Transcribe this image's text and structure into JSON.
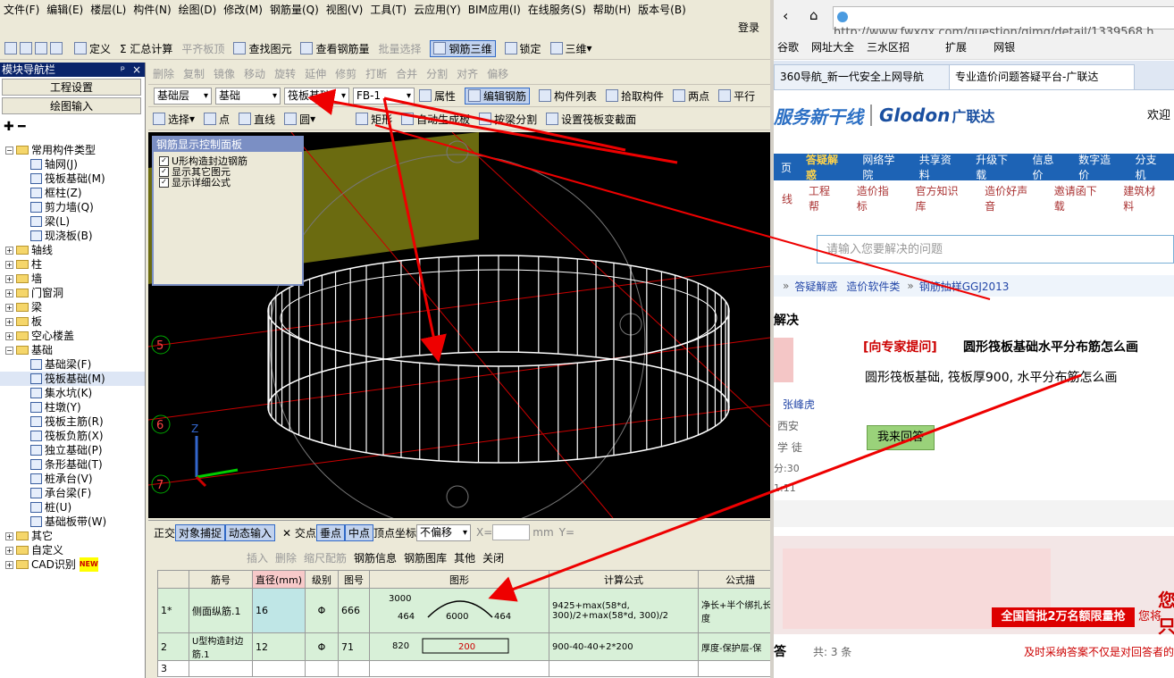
{
  "app": {
    "menu": [
      "文件(F)",
      "编辑(E)",
      "楼层(L)",
      "构件(N)",
      "绘图(D)",
      "修改(M)",
      "钢筋量(Q)",
      "视图(V)",
      "工具(T)",
      "云应用(Y)",
      "BIM应用(I)",
      "在线服务(S)",
      "帮助(H)",
      "版本号(B)"
    ],
    "login": "登录",
    "toolbar1": {
      "define": "定义",
      "sum": "Σ 汇总计算",
      "flat_top": "平齐板顶",
      "find": "查找图元",
      "view_rebar": "查看钢筋量",
      "batch": "批量选择",
      "rebar3d": "钢筋三维",
      "lock": "锁定",
      "view3d": "三维"
    },
    "toolbar2": [
      "删除",
      "复制",
      "镜像",
      "移动",
      "旋转",
      "延伸",
      "修剪",
      "打断",
      "合并",
      "分割",
      "对齐",
      "偏移"
    ],
    "toolbar3": {
      "layer": "基础层",
      "type": "基础",
      "component": "筏板基础",
      "name": "FB-1",
      "props": "属性",
      "edit_rebar": "编辑钢筋",
      "list": "构件列表",
      "pick": "拾取构件",
      "two_point": "两点",
      "parallel": "平行"
    },
    "toolbar4": {
      "select": "选择",
      "point": "点",
      "line": "直线",
      "circle": "圆",
      "rect": "矩形",
      "auto": "自动生成板",
      "split": "按梁分割",
      "set_slope": "设置筏板变截面"
    },
    "nav": {
      "title": "模块导航栏",
      "pin": "ᵖ",
      "close": "×",
      "btn1": "工程设置",
      "btn2": "绘图输入",
      "tree": [
        {
          "level": 0,
          "pm": "−",
          "label": "常用构件类型",
          "folder": true
        },
        {
          "level": 2,
          "label": "轴网(J)"
        },
        {
          "level": 2,
          "label": "筏板基础(M)"
        },
        {
          "level": 2,
          "label": "框柱(Z)"
        },
        {
          "level": 2,
          "label": "剪力墙(Q)"
        },
        {
          "level": 2,
          "label": "梁(L)"
        },
        {
          "level": 2,
          "label": "现浇板(B)"
        },
        {
          "level": 0,
          "pm": "+",
          "label": "轴线",
          "folder": true
        },
        {
          "level": 0,
          "pm": "+",
          "label": "柱",
          "folder": true
        },
        {
          "level": 0,
          "pm": "+",
          "label": "墙",
          "folder": true
        },
        {
          "level": 0,
          "pm": "+",
          "label": "门窗洞",
          "folder": true
        },
        {
          "level": 0,
          "pm": "+",
          "label": "梁",
          "folder": true
        },
        {
          "level": 0,
          "pm": "+",
          "label": "板",
          "folder": true
        },
        {
          "level": 0,
          "pm": "+",
          "label": "空心楼盖",
          "folder": true
        },
        {
          "level": 0,
          "pm": "−",
          "label": "基础",
          "folder": true
        },
        {
          "level": 2,
          "label": "基础梁(F)"
        },
        {
          "level": 2,
          "label": "筏板基础(M)",
          "selected": true
        },
        {
          "level": 2,
          "label": "集水坑(K)"
        },
        {
          "level": 2,
          "label": "柱墩(Y)"
        },
        {
          "level": 2,
          "label": "筏板主筋(R)"
        },
        {
          "level": 2,
          "label": "筏板负筋(X)"
        },
        {
          "level": 2,
          "label": "独立基础(P)"
        },
        {
          "level": 2,
          "label": "条形基础(T)"
        },
        {
          "level": 2,
          "label": "桩承台(V)"
        },
        {
          "level": 2,
          "label": "承台梁(F)"
        },
        {
          "level": 2,
          "label": "桩(U)"
        },
        {
          "level": 2,
          "label": "基础板带(W)"
        },
        {
          "level": 0,
          "pm": "+",
          "label": "其它",
          "folder": true
        },
        {
          "level": 0,
          "pm": "+",
          "label": "自定义",
          "folder": true
        },
        {
          "level": 0,
          "pm": "+",
          "label": "CAD识别",
          "folder": true,
          "badge": "NEW"
        }
      ]
    },
    "panel": {
      "title": "钢筋显示控制面板",
      "items": [
        "U形构造封边钢筋",
        "显示其它图元",
        "显示详细公式"
      ]
    },
    "axis": {
      "labels": [
        "5",
        "6",
        "7"
      ],
      "z": "Z"
    },
    "snap": {
      "ortho": "正交",
      "osnap": "对象捕捉",
      "dynamic": "动态输入",
      "intersect": "交点",
      "perp": "垂点",
      "mid": "中点",
      "vertex": "顶点",
      "coord": "坐标",
      "offset": "不偏移",
      "x": "X=",
      "mm": "mm",
      "y": "Y="
    },
    "rebar_toolbar": [
      "插入",
      "删除",
      "缩尺配筋",
      "钢筋信息",
      "钢筋图库",
      "其他",
      "关闭"
    ],
    "table": {
      "headers": [
        "",
        "筋号",
        "直径(mm)",
        "级别",
        "图号",
        "图形",
        "计算公式",
        "公式描"
      ],
      "rows": [
        {
          "idx": "1*",
          "name": "侧面纵筋.1",
          "dia": "16",
          "grade": "Φ",
          "fig": "666",
          "shape": {
            "top": "3000",
            "left": "464",
            "mid": "6000",
            "right": "464"
          },
          "formula": "9425+max(58*d, 300)/2+max(58*d, 300)/2",
          "desc": "净长+半个绑扎长度"
        },
        {
          "idx": "2",
          "name": "U型构造封边筋.1",
          "dia": "12",
          "grade": "Φ",
          "fig": "71",
          "shape": {
            "left": "820",
            "mid": "200"
          },
          "formula": "900-40-40+2*200",
          "desc": "厚度-保护层-保"
        },
        {
          "idx": "3",
          "name": "",
          "dia": "",
          "grade": "",
          "fig": "",
          "shape": {},
          "formula": "",
          "desc": ""
        }
      ]
    }
  },
  "browser": {
    "url": "http://www.fwxgx.com/question/gimq/detail/1339568.h",
    "favs": [
      "谷歌",
      "网址大全",
      "三水区招",
      "扩展",
      "网银"
    ],
    "tabs": [
      "360导航_新一代安全上网导航",
      "专业造价问题答疑平台-广联达"
    ],
    "logo_cn": "服务新干线",
    "logo_en": "Glodon",
    "logo_brand": "广联达",
    "welcome": "欢迎",
    "nav1": [
      "页",
      "答疑解惑",
      "网络学院",
      "共享资料",
      "升级下载",
      "信息价",
      "数字造价",
      "分支机"
    ],
    "nav2": [
      "线",
      "工程帮",
      "造价指标",
      "官方知识库",
      "造价好声音",
      "邀请函下载",
      "建筑材料"
    ],
    "search_placeholder": "请输入您要解决的问题",
    "crumbs": [
      "答疑解惑",
      "造价软件类",
      "钢筋抽样GGJ2013"
    ],
    "section": "解决",
    "question_tag": "[向专家提问]",
    "question_title": "圆形筏板基础水平分布筋怎么画",
    "question_body": "圆形筏板基础, 筏板厚900, 水平分布筋怎么画",
    "user": "张峰虎",
    "city": "西安",
    "level": "学 徒",
    "score": "分:30",
    "extra": "1:11",
    "answer_btn": "我来回答",
    "banner_text": "全国首批2万名额限量抢",
    "banner_tail": "您将",
    "banner_title": "您只",
    "answer_label": "答",
    "answer_count": "共: 3 条",
    "footer_note": "及时采纳答案不仅是对回答者的"
  }
}
